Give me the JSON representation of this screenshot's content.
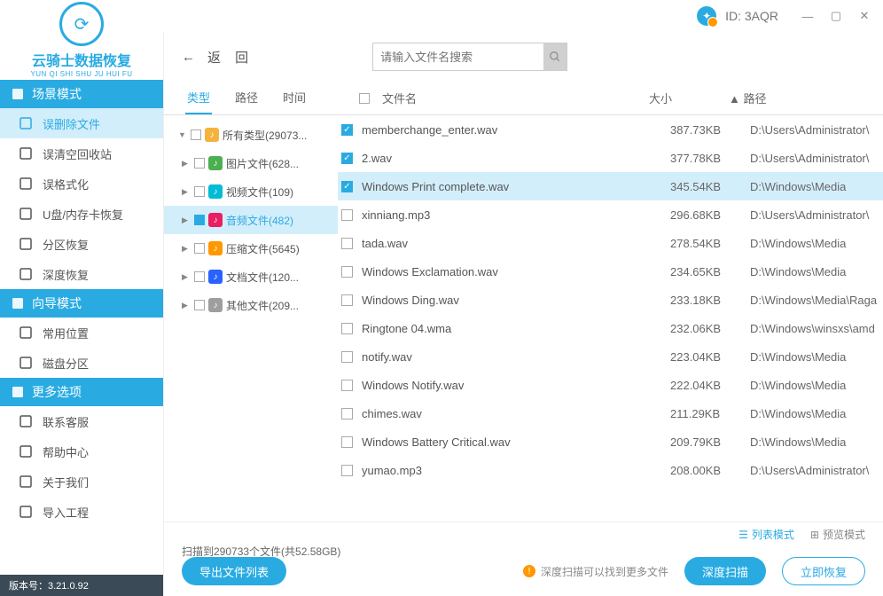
{
  "titlebar": {
    "id_label": "ID: 3AQR"
  },
  "logo": {
    "title": "云骑士数据恢复",
    "sub": "YUN QI SHI SHU JU HUI FU"
  },
  "sidebar": {
    "groups": [
      {
        "header": "场景模式",
        "items": [
          {
            "label": "误删除文件",
            "selected": true,
            "icon": "#29abe2"
          },
          {
            "label": "误清空回收站",
            "icon": "#555"
          },
          {
            "label": "误格式化",
            "icon": "#555"
          },
          {
            "label": "U盘/内存卡恢复",
            "icon": "#555"
          },
          {
            "label": "分区恢复",
            "icon": "#555"
          },
          {
            "label": "深度恢复",
            "icon": "#555"
          }
        ]
      },
      {
        "header": "向导模式",
        "items": [
          {
            "label": "常用位置",
            "icon": "#555"
          },
          {
            "label": "磁盘分区",
            "icon": "#555"
          }
        ]
      },
      {
        "header": "更多选项",
        "items": [
          {
            "label": "联系客服",
            "icon": "#555"
          },
          {
            "label": "帮助中心",
            "icon": "#555"
          },
          {
            "label": "关于我们",
            "icon": "#555"
          },
          {
            "label": "导入工程",
            "icon": "#555"
          }
        ]
      }
    ],
    "version": "版本号：3.21.0.92"
  },
  "toolbar": {
    "back": "返  回",
    "search_placeholder": "请输入文件名搜索"
  },
  "tabs": {
    "items": [
      "类型",
      "路径",
      "时间"
    ],
    "active": 0
  },
  "columns": {
    "name": "文件名",
    "size": "大小",
    "path": "▲ 路径"
  },
  "tree": [
    {
      "label": "所有类型(29073...",
      "expanded": true,
      "color": "#f3b33e",
      "level": 0
    },
    {
      "label": "图片文件(628...",
      "color": "#4caf50",
      "level": 1
    },
    {
      "label": "视频文件(109)",
      "color": "#00bcd4",
      "level": 1
    },
    {
      "label": "音频文件(482)",
      "color": "#e91e63",
      "level": 1,
      "selected": true,
      "checked": true
    },
    {
      "label": "压缩文件(5645)",
      "color": "#ff9800",
      "level": 1
    },
    {
      "label": "文档文件(120...",
      "color": "#2962ff",
      "level": 1
    },
    {
      "label": "其他文件(209...",
      "color": "#9e9e9e",
      "level": 1
    }
  ],
  "files": [
    {
      "name": "memberchange_enter.wav",
      "size": "387.73KB",
      "path": "D:\\Users\\Administrator\\",
      "checked": true
    },
    {
      "name": "2.wav",
      "size": "377.78KB",
      "path": "D:\\Users\\Administrator\\",
      "checked": true
    },
    {
      "name": "Windows Print complete.wav",
      "size": "345.54KB",
      "path": "D:\\Windows\\Media",
      "checked": true,
      "selected": true
    },
    {
      "name": "xinniang.mp3",
      "size": "296.68KB",
      "path": "D:\\Users\\Administrator\\"
    },
    {
      "name": "tada.wav",
      "size": "278.54KB",
      "path": "D:\\Windows\\Media"
    },
    {
      "name": "Windows Exclamation.wav",
      "size": "234.65KB",
      "path": "D:\\Windows\\Media"
    },
    {
      "name": "Windows Ding.wav",
      "size": "233.18KB",
      "path": "D:\\Windows\\Media\\Raga"
    },
    {
      "name": "Ringtone 04.wma",
      "size": "232.06KB",
      "path": "D:\\Windows\\winsxs\\amd"
    },
    {
      "name": "notify.wav",
      "size": "223.04KB",
      "path": "D:\\Windows\\Media"
    },
    {
      "name": "Windows Notify.wav",
      "size": "222.04KB",
      "path": "D:\\Windows\\Media"
    },
    {
      "name": "chimes.wav",
      "size": "211.29KB",
      "path": "D:\\Windows\\Media"
    },
    {
      "name": "Windows Battery Critical.wav",
      "size": "209.79KB",
      "path": "D:\\Windows\\Media"
    },
    {
      "name": "yumao.mp3",
      "size": "208.00KB",
      "path": "D:\\Users\\Administrator\\"
    }
  ],
  "viewbar": {
    "list": "列表模式",
    "preview": "预览模式"
  },
  "footer": {
    "scan_info": "扫描到290733个文件(共52.58GB)",
    "export": "导出文件列表",
    "deep_hint": "深度扫描可以找到更多文件",
    "deep_scan": "深度扫描",
    "recover": "立即恢复"
  }
}
